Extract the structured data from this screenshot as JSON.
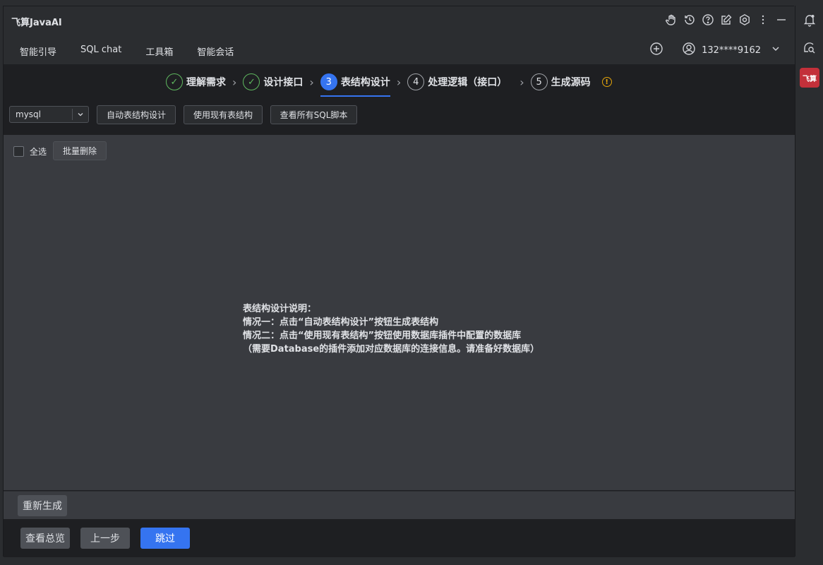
{
  "app": {
    "title": "飞算JavaAI"
  },
  "tabs": [
    {
      "label": "智能引导",
      "active": true
    },
    {
      "label": "SQL chat",
      "active": false
    },
    {
      "label": "工具箱",
      "active": false
    },
    {
      "label": "智能会话",
      "active": false
    }
  ],
  "header_icons": [
    "hand-icon",
    "history-icon",
    "help-icon",
    "edit-icon",
    "settings-icon",
    "more-icon",
    "minimize-icon"
  ],
  "user": {
    "phone": "132****9162"
  },
  "steps": [
    {
      "number": "✓",
      "label": "理解需求",
      "state": "done"
    },
    {
      "number": "✓",
      "label": "设计接口",
      "state": "done"
    },
    {
      "number": "3",
      "label": "表结构设计",
      "state": "current"
    },
    {
      "number": "4",
      "label": "处理逻辑（接口）",
      "state": "todo"
    },
    {
      "number": "5",
      "label": "生成源码",
      "state": "todo"
    }
  ],
  "toolbar": {
    "db_type": "mysql",
    "btn_auto": "自动表结构设计",
    "btn_existing": "使用现有表结构",
    "btn_view_sql": "查看所有SQL脚本"
  },
  "content": {
    "select_all": "全选",
    "batch_delete": "批量删除",
    "instruction_title": "表结构设计说明：",
    "instruction_1": "情况一：点击“自动表结构设计”按钮生成表结构",
    "instruction_2": "情况二：点击“使用现有表结构”按钮使用数据库插件中配置的数据库",
    "instruction_3": "（需要Database的插件添加对应数据库的连接信息。请准备好数据库）"
  },
  "regen": {
    "label": "重新生成"
  },
  "footer": {
    "overview": "查看总览",
    "prev": "上一步",
    "skip": "跳过"
  },
  "right_strip": {
    "logo_text": "飞算"
  },
  "colors": {
    "accent": "#3574f0",
    "done": "#5fb85f",
    "warning": "#e5a50a",
    "logo": "#c3303a"
  }
}
